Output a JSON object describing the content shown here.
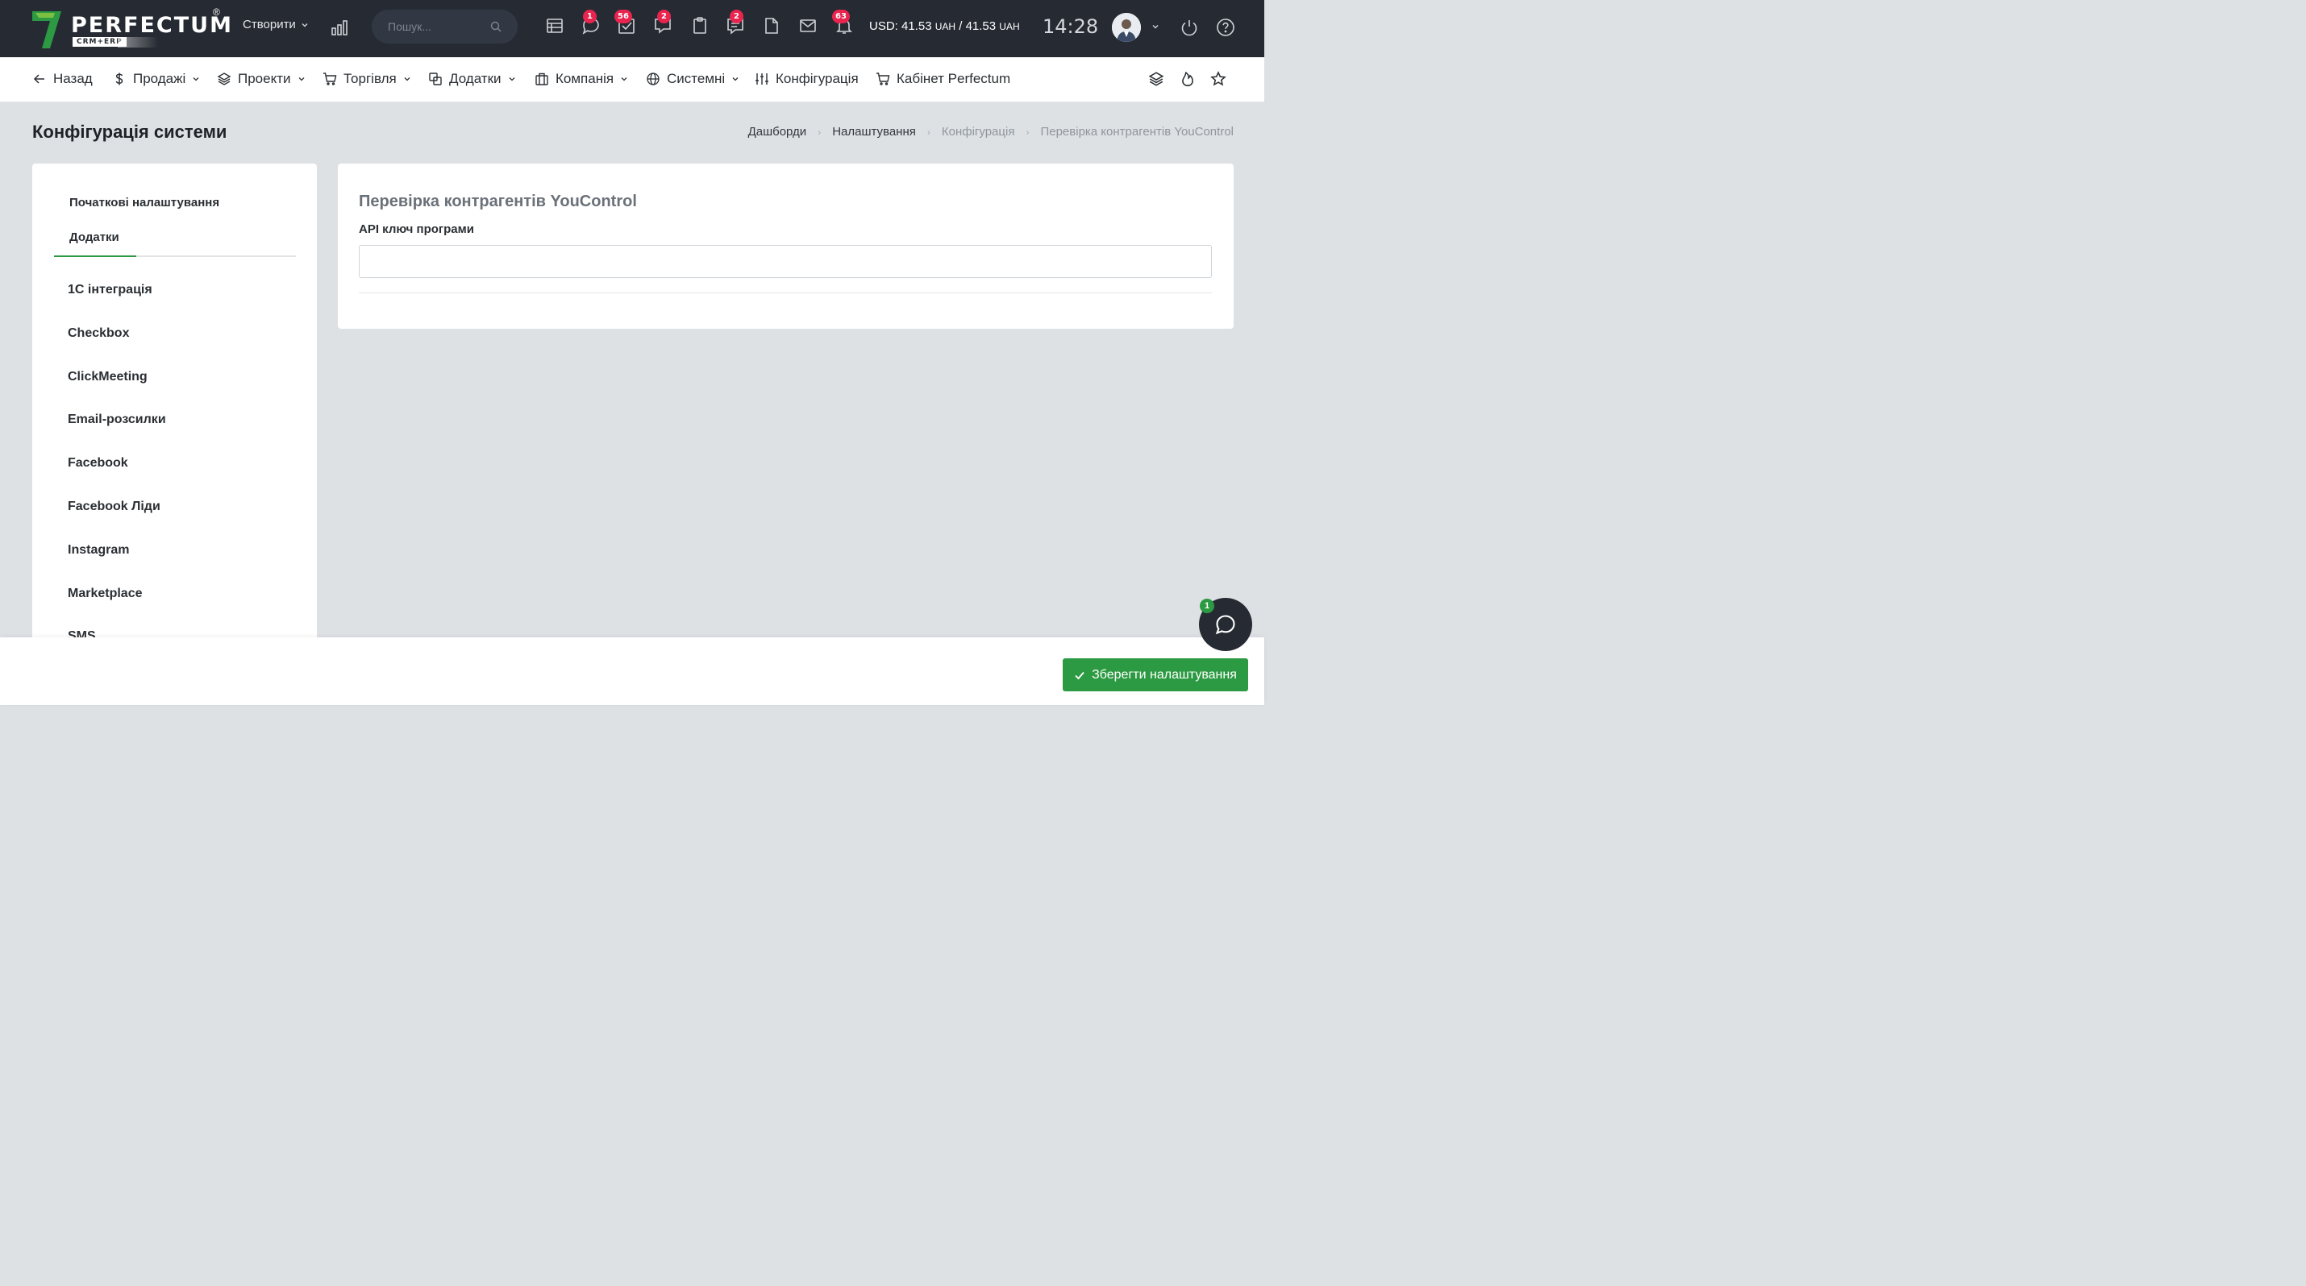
{
  "header": {
    "logo_text": "PERFECTUM",
    "logo_sub": "CRM+ERP",
    "logo_reg": "®",
    "create_label": "Створити",
    "search_placeholder": "Пошук...",
    "badges": {
      "chat": "1",
      "tasks": "56",
      "comments": "2",
      "notes": "2",
      "notifications": "63"
    },
    "currency": {
      "prefix": "USD: 41.53",
      "unit1": "UAH",
      "mid": " / 41.53 ",
      "unit2": "UAH"
    },
    "time": "14:28"
  },
  "nav": {
    "back": "Назад",
    "sales": "Продажі",
    "projects": "Проекти",
    "trade": "Торгівля",
    "addons": "Додатки",
    "company": "Компанія",
    "system": "Системні",
    "config": "Конфігурація",
    "cabinet": "Кабінет Perfectum"
  },
  "page": {
    "title": "Конфігурація системи",
    "breadcrumb": [
      "Дашборди",
      "Налаштування",
      "Конфігурація",
      "Перевірка контрагентів YouControl"
    ]
  },
  "sidebar": {
    "tabs": [
      "Початкові налаштування",
      "Додатки"
    ],
    "active_tab": "Додатки",
    "items": [
      "1С інтеграція",
      "Checkbox",
      "ClickMeeting",
      "Email-розсилки",
      "Facebook",
      "Facebook Ліди",
      "Instagram",
      "Marketplace",
      "SMS"
    ]
  },
  "card": {
    "title": "Перевірка контрагентів YouControl",
    "api_label": "API ключ програми",
    "api_value": ""
  },
  "footer": {
    "save_label": "Зберегти налаштування",
    "chat_badge": "1"
  },
  "colors": {
    "accent": "#2c9a42",
    "badge": "#e8244f",
    "topbar": "#262b33"
  }
}
